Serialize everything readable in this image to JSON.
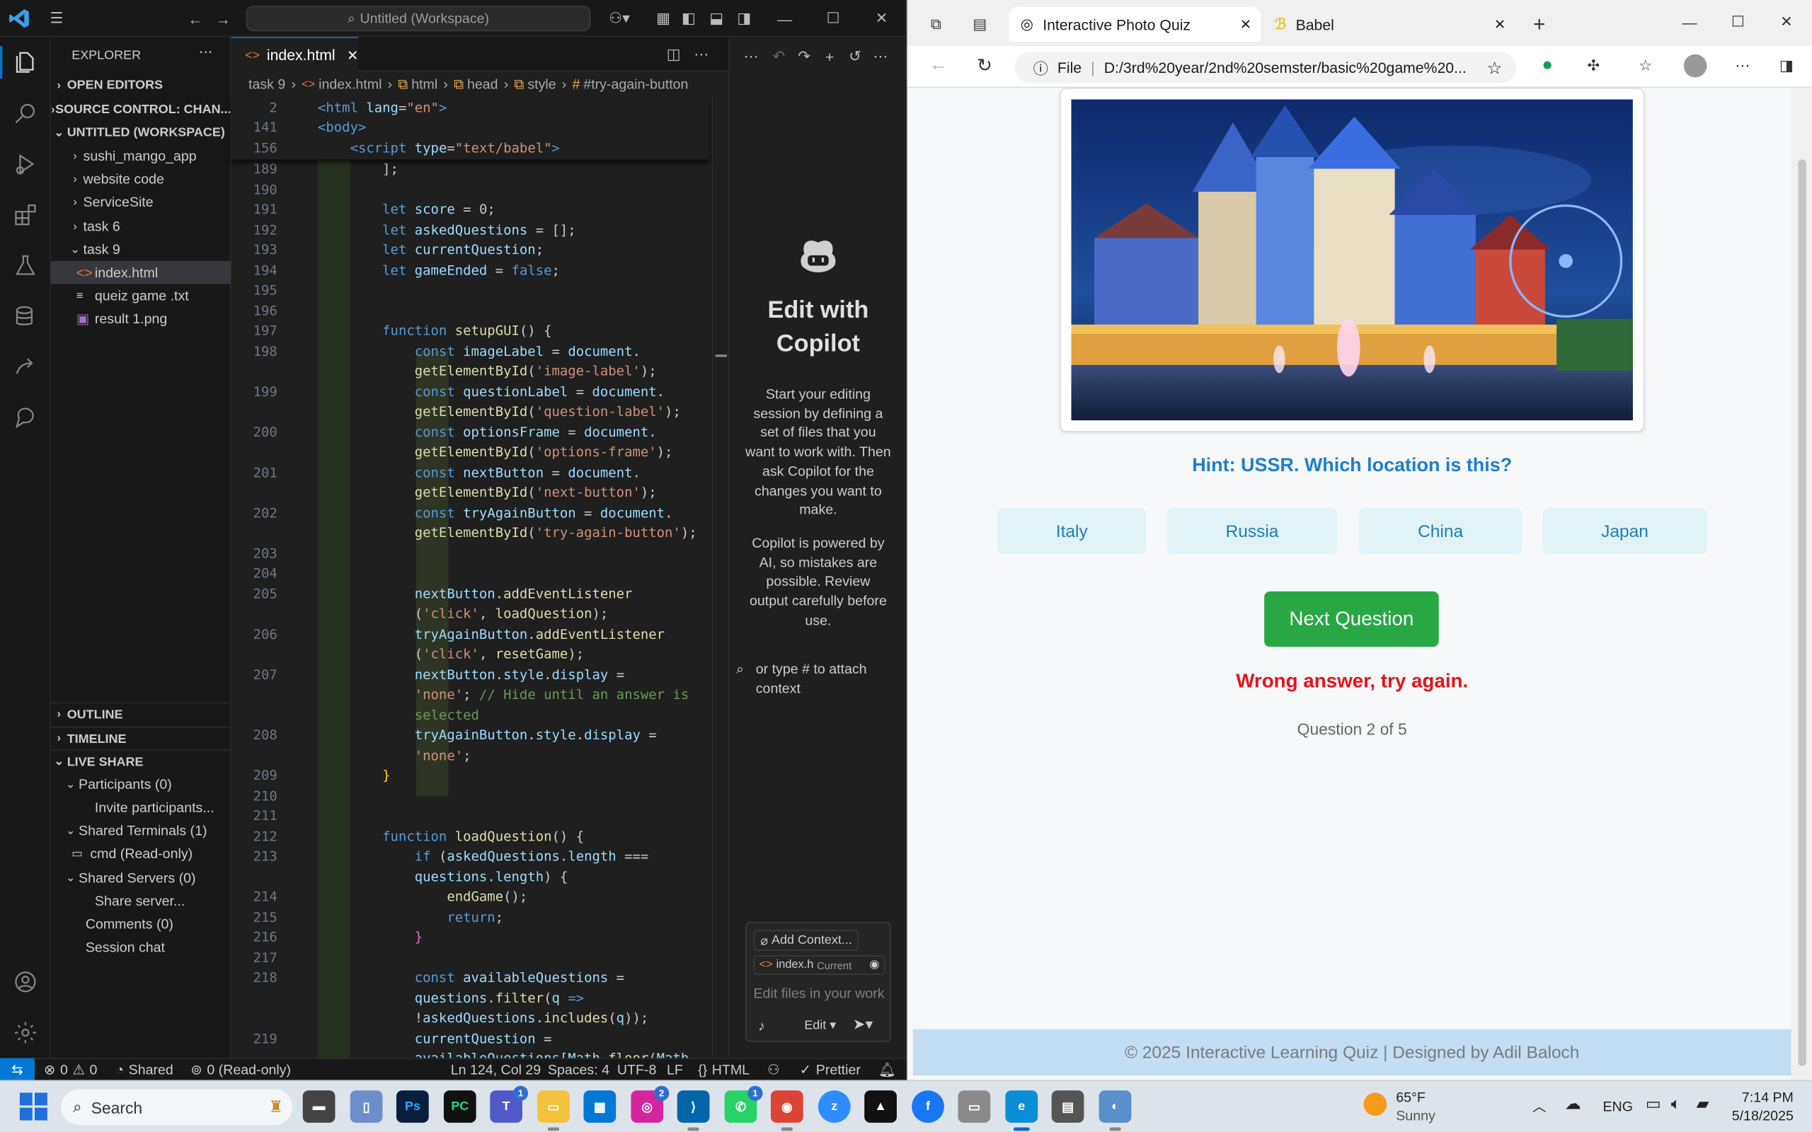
{
  "vscode": {
    "title": "Untitled (Workspace)",
    "explorer_title": "EXPLORER",
    "sections": {
      "open_editors": "OPEN EDITORS",
      "source_control": "SOURCE CONTROL: CHAN...",
      "workspace": "UNTITLED (WORKSPACE)",
      "outline": "OUTLINE",
      "timeline": "TIMELINE",
      "live_share": "LIVE SHARE"
    },
    "tree": [
      {
        "label": "sushi_mango_app",
        "type": "folder"
      },
      {
        "label": "website code",
        "type": "folder"
      },
      {
        "label": "ServiceSite",
        "type": "folder"
      },
      {
        "label": "task 6",
        "type": "folder"
      },
      {
        "label": "task 9",
        "type": "folder-open"
      },
      {
        "label": "index.html",
        "type": "html"
      },
      {
        "label": "queiz game .txt",
        "type": "txt"
      },
      {
        "label": "result 1.png",
        "type": "png"
      }
    ],
    "live_share": {
      "participants": "Participants (0)",
      "invite": "Invite participants...",
      "terminals": "Shared Terminals (1)",
      "cmd": "cmd (Read-only)",
      "servers": "Shared Servers (0)",
      "share_server": "Share server...",
      "comments": "Comments (0)",
      "session_chat": "Session chat"
    },
    "tab": "index.html",
    "breadcrumb": [
      "task 9",
      "index.html",
      "html",
      "head",
      "style",
      "#try-again-button"
    ],
    "copilot": {
      "title": "Edit with Copilot",
      "desc": "Start your editing session by defining a set of files that you want to work with. Then ask Copilot for the changes you want to make.",
      "note": "Copilot is powered by AI, so mistakes are possible. Review output carefully before use.",
      "hint": "or type # to attach context",
      "add_context": "Add Context...",
      "file_chip": "index.h",
      "file_chip_tag": "Current",
      "input_placeholder": "Edit files in your work",
      "mode": "Edit"
    },
    "status": {
      "errors": "0",
      "warnings": "0",
      "shared": "Shared",
      "readonly": "0 (Read-only)",
      "position": "Ln 124, Col 29",
      "spaces": "Spaces: 4",
      "encoding": "UTF-8",
      "eol": "LF",
      "lang": "HTML",
      "prettier": "Prettier"
    }
  },
  "browser": {
    "tabs": [
      "Interactive Photo Quiz",
      "Babel"
    ],
    "url_prefix": "File",
    "url": "D:/3rd%20year/2nd%20semster/basic%20game%20...",
    "quiz": {
      "hint": "Hint: USSR. Which location is this?",
      "options": [
        "Italy",
        "Russia",
        "China",
        "Japan"
      ],
      "next_button": "Next Question",
      "feedback": "Wrong answer, try again.",
      "progress": "Question 2 of 5",
      "footer": "© 2025 Interactive Learning Quiz | Designed by Adil Baloch"
    }
  },
  "taskbar": {
    "search": "Search",
    "weather_temp": "65°F",
    "weather_desc": "Sunny",
    "lang": "ENG",
    "time": "7:14 PM",
    "date": "5/18/2025",
    "badges": {
      "teams": "1",
      "instagram": "2",
      "whatsapp": "1"
    }
  }
}
